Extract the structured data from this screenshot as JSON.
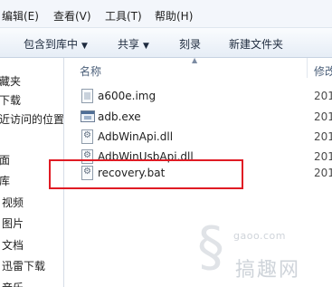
{
  "menubar": {
    "items": [
      "编辑(E)",
      "查看(V)",
      "工具(T)",
      "帮助(H)"
    ]
  },
  "toolbar": {
    "include_library": "包含到库中",
    "share": "共享",
    "burn": "刻录",
    "new_folder": "新建文件夹"
  },
  "nav_pane": {
    "items": [
      "藏夹",
      "下载",
      "近访问的位置",
      "面",
      "库",
      "视频",
      "图片",
      "文档",
      "迅雷下载",
      "音乐"
    ]
  },
  "columns": {
    "name": "名称",
    "modified": "修改"
  },
  "files": [
    {
      "name": "a600e.img",
      "date": "201",
      "icon": "image-file-icon"
    },
    {
      "name": "adb.exe",
      "date": "201",
      "icon": "exe-file-icon"
    },
    {
      "name": "AdbWinApi.dll",
      "date": "201",
      "icon": "dll-file-icon"
    },
    {
      "name": "AdbWinUsbApi.dll",
      "date": "201",
      "icon": "dll-file-icon"
    },
    {
      "name": "recovery.bat",
      "date": "201",
      "icon": "bat-file-icon"
    }
  ],
  "annotation": {
    "highlight_color": "#e01b24"
  },
  "watermark": {
    "url": "gaoo.com",
    "site": "搞趣网"
  }
}
